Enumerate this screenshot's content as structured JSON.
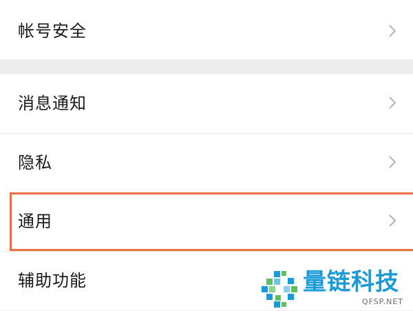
{
  "settings": {
    "items": [
      {
        "label": "帐号安全",
        "icon": "chevron-right-icon"
      },
      {
        "label": "消息通知",
        "icon": "chevron-right-icon"
      },
      {
        "label": "隐私",
        "icon": "chevron-right-icon"
      },
      {
        "label": "通用",
        "icon": "chevron-right-icon",
        "highlighted": true
      },
      {
        "label": "辅助功能",
        "icon": "chevron-right-icon"
      }
    ]
  },
  "watermark": {
    "title": "量链科技",
    "subtitle": "QFSP.NET"
  },
  "colors": {
    "background": "#ededed",
    "row": "#ffffff",
    "text": "#1a1a1a",
    "chevron": "#b2b2b2",
    "highlight": "#e8703f",
    "watermark_blue": "#1a9bd8",
    "watermark_green": "#5cc15a"
  }
}
